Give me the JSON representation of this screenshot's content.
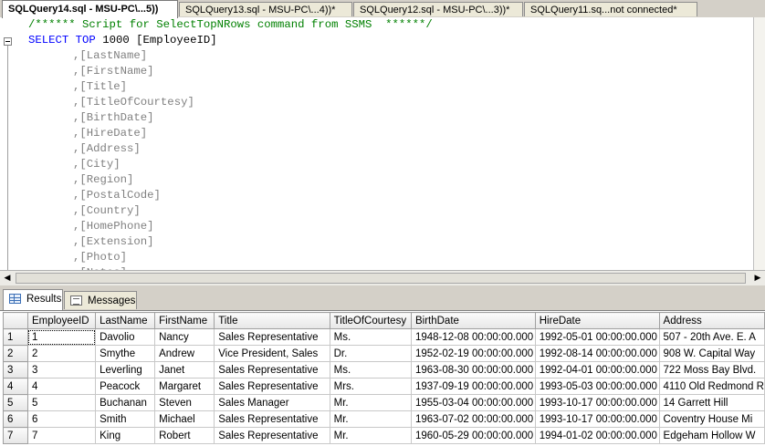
{
  "tabs": [
    {
      "label": "SQLQuery14.sql - MSU-PC\\...5))",
      "active": true
    },
    {
      "label": "SQLQuery13.sql - MSU-PC\\...4))*",
      "active": false
    },
    {
      "label": "SQLQuery12.sql - MSU-PC\\...3))*",
      "active": false
    },
    {
      "label": "SQLQuery11.sq...not connected*",
      "active": false
    }
  ],
  "editor": {
    "comment": "/****** Script for SelectTopNRows command from SSMS  ******/",
    "select_kw": "SELECT",
    "top_kw": "TOP",
    "top_rest": " 1000 [EmployeeID]",
    "columns": [
      ",[LastName]",
      ",[FirstName]",
      ",[Title]",
      ",[TitleOfCourtesy]",
      ",[BirthDate]",
      ",[HireDate]",
      ",[Address]",
      ",[City]",
      ",[Region]",
      ",[PostalCode]",
      ",[Country]",
      ",[HomePhone]",
      ",[Extension]",
      ",[Photo]",
      ",[Notes]"
    ]
  },
  "scroll": {
    "left_arrow": "◀",
    "right_arrow": "▶"
  },
  "result_tabs": [
    {
      "label": "Results",
      "icon": "grid-icon",
      "active": true
    },
    {
      "label": "Messages",
      "icon": "messages-icon",
      "active": false
    }
  ],
  "grid": {
    "columns": [
      "",
      "EmployeeID",
      "LastName",
      "FirstName",
      "Title",
      "TitleOfCourtesy",
      "BirthDate",
      "HireDate",
      "Address"
    ],
    "rows": [
      [
        "1",
        "1",
        "Davolio",
        "Nancy",
        "Sales Representative",
        "Ms.",
        "1948-12-08 00:00:00.000",
        "1992-05-01 00:00:00.000",
        "507 - 20th Ave. E. A"
      ],
      [
        "2",
        "2",
        "Smythe",
        "Andrew",
        "Vice President, Sales",
        "Dr.",
        "1952-02-19 00:00:00.000",
        "1992-08-14 00:00:00.000",
        "908 W. Capital Way"
      ],
      [
        "3",
        "3",
        "Leverling",
        "Janet",
        "Sales Representative",
        "Ms.",
        "1963-08-30 00:00:00.000",
        "1992-04-01 00:00:00.000",
        "722 Moss Bay Blvd."
      ],
      [
        "4",
        "4",
        "Peacock",
        "Margaret",
        "Sales Representative",
        "Mrs.",
        "1937-09-19 00:00:00.000",
        "1993-05-03 00:00:00.000",
        "4110 Old Redmond R"
      ],
      [
        "5",
        "5",
        "Buchanan",
        "Steven",
        "Sales Manager",
        "Mr.",
        "1955-03-04 00:00:00.000",
        "1993-10-17 00:00:00.000",
        "14 Garrett Hill"
      ],
      [
        "6",
        "6",
        "Smith",
        "Michael",
        "Sales Representative",
        "Mr.",
        "1963-07-02 00:00:00.000",
        "1993-10-17 00:00:00.000",
        "Coventry House  Mi"
      ],
      [
        "7",
        "7",
        "King",
        "Robert",
        "Sales Representative",
        "Mr.",
        "1960-05-29 00:00:00.000",
        "1994-01-02 00:00:00.000",
        "Edgeham Hollow  W"
      ]
    ]
  }
}
